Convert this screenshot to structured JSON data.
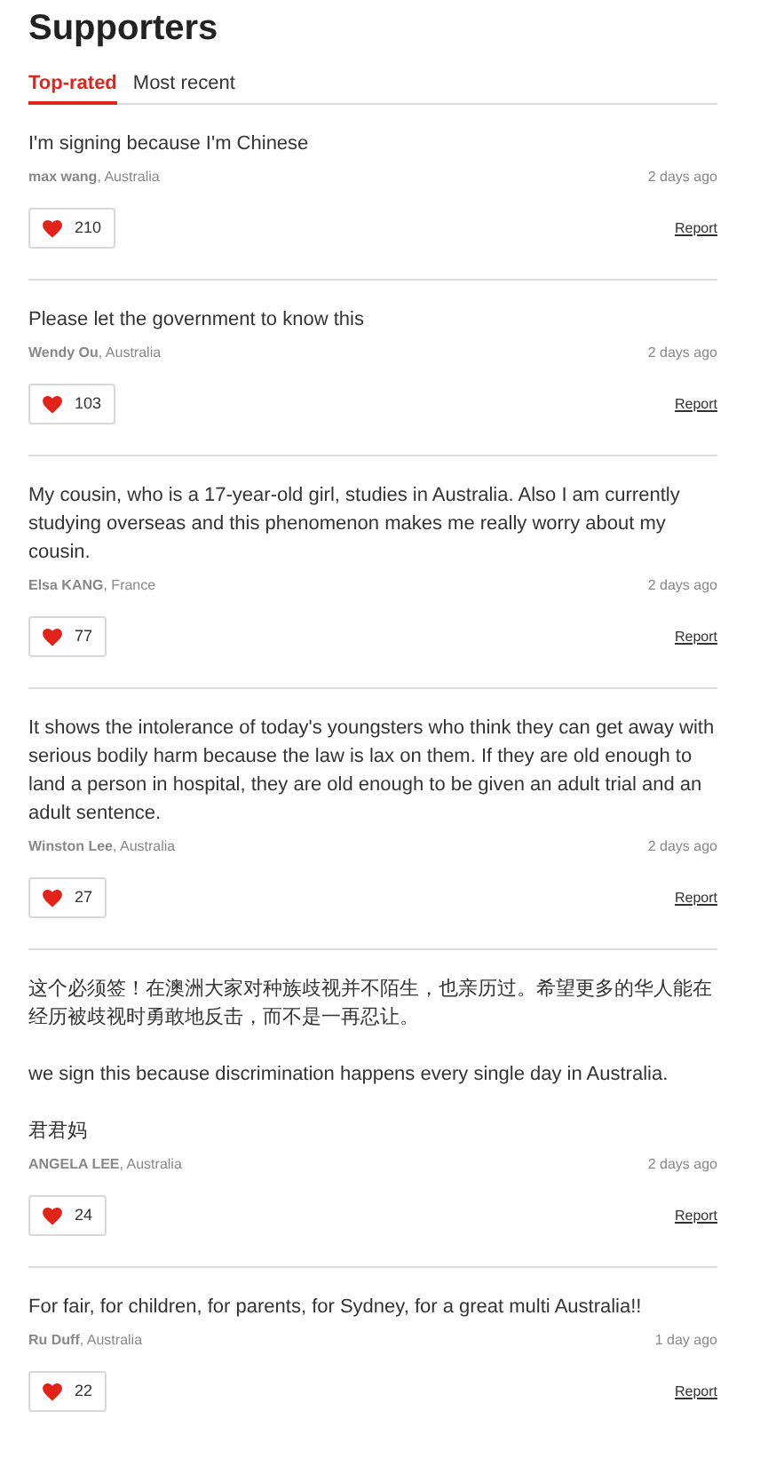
{
  "title": "Supporters",
  "tabs": [
    {
      "label": "Top-rated",
      "selected": true
    },
    {
      "label": "Most recent",
      "selected": false
    }
  ],
  "comments": [
    {
      "paragraphs": [
        "I'm signing because I'm Chinese"
      ],
      "byline": "**max wang**, Australia",
      "time": "2 days ago",
      "likes": "210",
      "report": "Report"
    },
    {
      "paragraphs": [
        "Please let the government to know this"
      ],
      "byline": "**Wendy Ou**, Australia",
      "time": "2 days ago",
      "likes": "103",
      "report": "Report"
    },
    {
      "paragraphs": [
        "My cousin, who is a 17-year-old girl, studies in Australia. Also I am currently studying overseas and this phenomenon makes me really worry about my cousin."
      ],
      "byline": "**Elsa KANG**, France",
      "time": "2 days ago",
      "likes": "77",
      "report": "Report"
    },
    {
      "paragraphs": [
        "It shows the intolerance of today's youngsters who think they can get away with serious bodily harm because the law is lax on them. If they are old enough to land a person in hospital, they are old enough to be given an adult trial and an adult sentence."
      ],
      "byline": "**Winston Lee**, Australia",
      "time": "2 days ago",
      "likes": "27",
      "report": "Report"
    },
    {
      "paragraphs": [
        "这个必须签！在澳洲大家对种族歧视并不陌生，也亲历过。希望更多的华人能在经历被歧视时勇敢地反击，而不是一再忍让。",
        "we sign this because discrimination happens every single day in Australia.",
        "君君妈"
      ],
      "byline": "**ANGELA LEE**, Australia",
      "time": "2 days ago",
      "likes": "24",
      "report": "Report"
    },
    {
      "paragraphs": [
        "For fair, for children, for parents, for Sydney, for a great multi Australia!!"
      ],
      "byline": "**Ru Duff**, Australia",
      "time": "1 day ago",
      "likes": "22",
      "report": "Report"
    }
  ]
}
